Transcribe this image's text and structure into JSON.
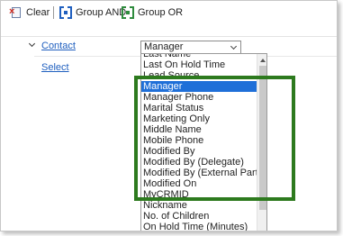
{
  "toolbar": {
    "clear_label": "Clear",
    "group_and_label": "Group AND",
    "group_or_label": "Group OR"
  },
  "condition": {
    "entity_link": "Contact",
    "select_link": "Select",
    "field_value": "Manager"
  },
  "dropdown": {
    "options": [
      "Last Name",
      "Last On Hold Time",
      "Lead Source",
      "Manager",
      "Manager Phone",
      "Marital Status",
      "Marketing Only",
      "Middle Name",
      "Mobile Phone",
      "Modified By",
      "Modified By (Delegate)",
      "Modified By (External Party)",
      "Modified On",
      "MyCRMID",
      "Nickname",
      "No. of Children",
      "On Hold Time (Minutes)"
    ],
    "selected": "Manager"
  },
  "colors": {
    "highlight": "#2d7a1e",
    "selection": "#1f6fd8",
    "link": "#1f5fbf"
  },
  "icons": [
    "clear-icon",
    "group-and-icon",
    "group-or-icon",
    "chevron-down-icon",
    "scroll-up-icon"
  ]
}
